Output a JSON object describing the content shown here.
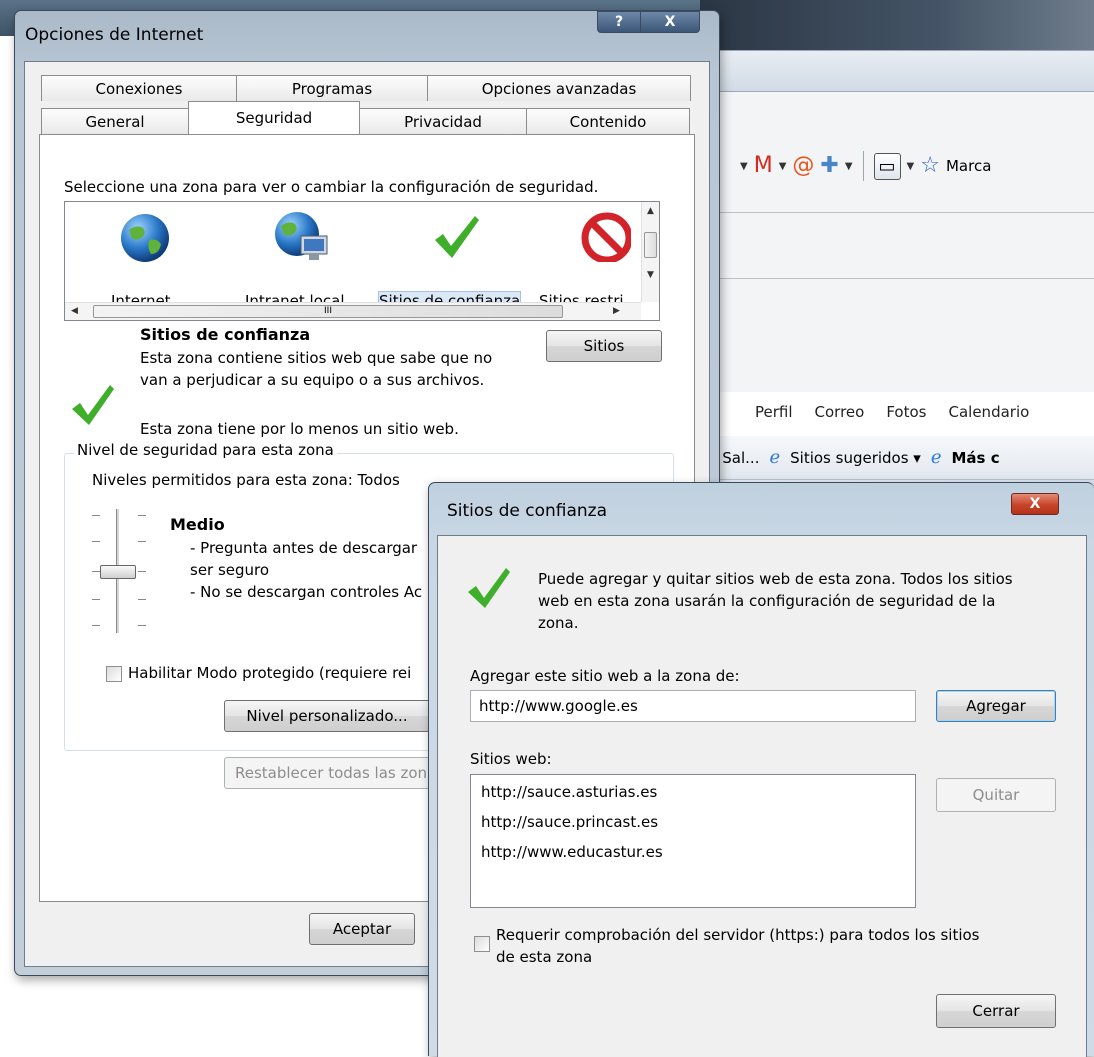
{
  "browser": {
    "toolbar_partial_label": "Marca",
    "links": [
      "Perfil",
      "Correo",
      "Fotos",
      "Calendario"
    ],
    "fav_partial": "n Sal...",
    "fav_suggested": "Sitios sugeridos ▾",
    "fav_more": "Más c"
  },
  "main_dialog": {
    "title": "Opciones de Internet",
    "help_btn": "?",
    "close_btn": "X",
    "tabs_back": [
      "Conexiones",
      "Programas",
      "Opciones avanzadas"
    ],
    "tabs_front": [
      "General",
      "Seguridad",
      "Privacidad",
      "Contenido"
    ],
    "active_tab": "Seguridad",
    "instruction": "Seleccione una zona para ver o cambiar la configuración de seguridad.",
    "zones": [
      "Internet",
      "Intranet local",
      "Sitios de confianza",
      "Sitios restri"
    ],
    "selected_zone": "Sitios de confianza",
    "hscroll_grip": "III",
    "zone_title": "Sitios de confianza",
    "zone_desc_1": "Esta zona contiene sitios web que sabe que no",
    "zone_desc_2": "van a perjudicar a su equipo o a sus archivos.",
    "zone_has_sites": "Esta zona tiene por lo menos un sitio web.",
    "sites_btn": "Sitios",
    "group_title": "Nivel de seguridad para esta zona",
    "allowed_levels": "Niveles permitidos para esta zona: Todos",
    "level_name": "Medio",
    "level_desc_1": "- Pregunta antes de descargar",
    "level_desc_2": "ser seguro",
    "level_desc_3": "- No se descargan controles Ac",
    "protected_mode": "Habilitar Modo protegido (requiere rei",
    "custom_level_btn": "Nivel personalizado...",
    "reset_btn": "Restablecer todas las zon",
    "ok_btn": "Aceptar"
  },
  "trusted_dialog": {
    "title": "Sitios de confianza",
    "close_btn": "X",
    "info_1": "Puede agregar y quitar sitios web de esta zona. Todos los sitios",
    "info_2": "web en esta zona usarán la configuración de seguridad de la",
    "info_3": "zona.",
    "add_label": "Agregar este sitio web a la zona de:",
    "add_value": "http://www.google.es",
    "add_btn": "Agregar",
    "sites_label": "Sitios web:",
    "sites": [
      "http://sauce.asturias.es",
      "http://sauce.princast.es",
      "http://www.educastur.es"
    ],
    "remove_btn": "Quitar",
    "https_1": "Requerir comprobación del servidor (https:) para todos los sitios",
    "https_2": "de esta zona",
    "close_dialog_btn": "Cerrar"
  },
  "colors": {
    "check_green": "#3fae2a",
    "selection_blue": "#dbe8f7",
    "title_blue": "#aab9c8"
  }
}
